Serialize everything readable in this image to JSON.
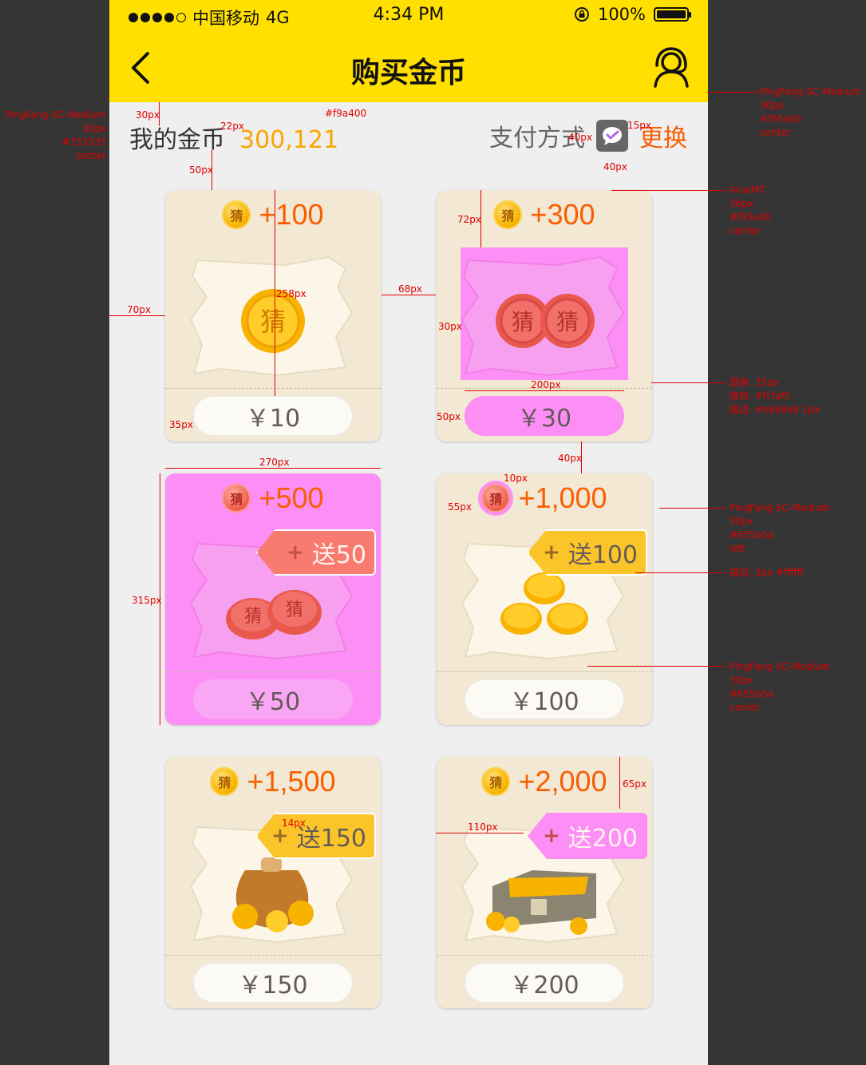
{
  "status_bar": {
    "carrier": "中国移动",
    "network": "4G",
    "time": "4:34 PM",
    "battery": "100%"
  },
  "nav": {
    "title": "购买金币",
    "back_icon": "chevron-left-icon",
    "user_icon": "user-headset-icon"
  },
  "balance": {
    "label": "我的金币",
    "value": "300,121"
  },
  "payment": {
    "label": "支付方式",
    "icon": "wechat-pay-icon",
    "change": "更换"
  },
  "colors": {
    "brand": "#ffe000",
    "coin_value": "#f9a400",
    "accent": "#f95e00",
    "price_text": "#655a5a",
    "highlight": "#fc8ef6"
  },
  "packages": [
    {
      "coin_glyph": "猜",
      "amount": "+100",
      "bonus": "",
      "price": "￥10"
    },
    {
      "coin_glyph": "猜",
      "amount": "+300",
      "bonus": "",
      "price": "￥30"
    },
    {
      "coin_glyph": "猜",
      "amount": "+500",
      "bonus": "送50",
      "price": "￥50"
    },
    {
      "coin_glyph": "猜",
      "amount": "+1,000",
      "bonus": "送100",
      "price": "￥100"
    },
    {
      "coin_glyph": "猜",
      "amount": "+1,500",
      "bonus": "送150",
      "price": "￥150"
    },
    {
      "coin_glyph": "猜",
      "amount": "+2,000",
      "bonus": "送200",
      "price": "￥200"
    }
  ],
  "annotations": {
    "a1": "PingFang-SC-Medium",
    "a1b": "30px",
    "a1c": "#333333",
    "a1d": "center",
    "a2": "#f9a400",
    "a3": "PingFang-SC-Medium",
    "a3b": "30px",
    "a3c": "#f95e00",
    "a3d": "center",
    "a4": "ArialMT",
    "a4b": "36px",
    "a4c": "#f95e00",
    "a4d": "center",
    "a5": "圆角: 25px",
    "a5b": "填充: #fcfaf5",
    "a5c": "描边: #e8e8e8 1px",
    "a6": "PingFang-SC-Medium",
    "a6b": "30px",
    "a6c": "#655a5a",
    "a6d": "left",
    "a7": "描边: 2px  #ffffff",
    "a8": "PingFang-SC-Medium",
    "a8b": "30px",
    "a8c": "#655a5a",
    "a8d": "center",
    "d30": "30px",
    "d22": "22px",
    "d50": "50px",
    "d40a": "40px",
    "d15": "15px",
    "d40b": "40px",
    "d72": "72px",
    "d258": "258px",
    "d68": "68px",
    "d70": "70px",
    "d30b": "30px",
    "d200": "200px",
    "d50b": "50px",
    "d35": "35px",
    "d40c": "40px",
    "d270": "270px",
    "d10": "10px",
    "d55": "55px",
    "d315": "315px",
    "d14": "14px",
    "d110": "110px",
    "d65": "65px"
  }
}
